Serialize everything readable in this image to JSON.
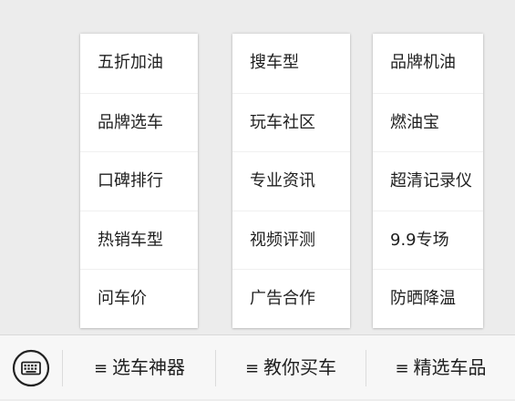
{
  "menus": [
    {
      "items": [
        "五折加油",
        "品牌选车",
        "口碑排行",
        "热销车型",
        "问车价"
      ]
    },
    {
      "items": [
        "搜车型",
        "玩车社区",
        "专业资讯",
        "视频评测",
        "广告合作"
      ]
    },
    {
      "items": [
        "品牌机油",
        "燃油宝",
        "超清记录仪",
        "9.9专场",
        "防晒降温"
      ]
    }
  ],
  "bottom_bar": {
    "keyboard_icon": "keyboard-icon",
    "menu_glyph": "≡",
    "tabs": [
      {
        "label": "选车神器"
      },
      {
        "label": "教你买车"
      },
      {
        "label": "精选车品"
      }
    ]
  },
  "colors": {
    "background": "#ececec",
    "menu_bg": "#ffffff",
    "text": "#1f1f1f",
    "bar_bg": "#f7f7f7"
  }
}
